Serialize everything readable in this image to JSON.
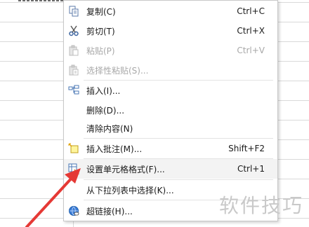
{
  "menu": {
    "items": [
      {
        "label": "复制(C)",
        "shortcut": "Ctrl+C",
        "icon": "copy-icon",
        "enabled": true
      },
      {
        "label": "剪切(T)",
        "shortcut": "Ctrl+X",
        "icon": "scissors-icon",
        "enabled": true
      },
      {
        "label": "粘贴(P)",
        "shortcut": "Ctrl+V",
        "icon": "paste-icon",
        "enabled": false
      },
      {
        "label": "选择性粘贴(S)...",
        "shortcut": "",
        "icon": "paste-special-icon",
        "enabled": false
      },
      {
        "label": "插入(I)...",
        "shortcut": "",
        "icon": "insert-cells-icon",
        "enabled": true
      },
      {
        "label": "删除(D)...",
        "shortcut": "",
        "icon": "",
        "enabled": true
      },
      {
        "label": "清除内容(N)",
        "shortcut": "",
        "icon": "",
        "enabled": true
      },
      {
        "label": "插入批注(M)...",
        "shortcut": "Shift+F2",
        "icon": "comment-icon",
        "enabled": true
      },
      {
        "label": "设置单元格格式(F)...",
        "shortcut": "Ctrl+1",
        "icon": "format-cells-icon",
        "enabled": true
      },
      {
        "label": "从下拉列表中选择(K)...",
        "shortcut": "",
        "icon": "",
        "enabled": true
      },
      {
        "label": "超链接(H)...",
        "shortcut": "",
        "icon": "hyperlink-icon",
        "enabled": true
      }
    ]
  },
  "watermark": "软件技巧",
  "colors": {
    "arrow": "#e53935",
    "menu_border": "#c8c8c8",
    "disabled_text": "#a8a8a8"
  }
}
